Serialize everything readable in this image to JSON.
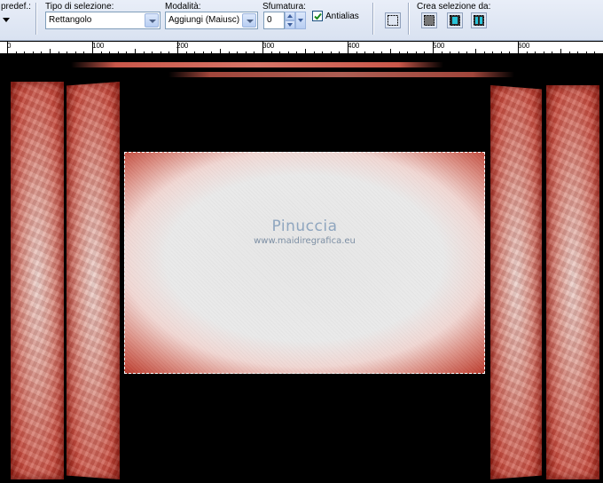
{
  "toolbar": {
    "preset_label": "predef.:",
    "selection_type": {
      "label": "Tipo di selezione:",
      "value": "Rettangolo"
    },
    "mode": {
      "label": "Modalità:",
      "value": "Aggiungi (Maiusc)"
    },
    "feather": {
      "label": "Sfumatura:",
      "value": "0"
    },
    "antialias": {
      "label": "Antialias",
      "checked": true
    },
    "create_selection": {
      "label": "Crea selezione da:"
    }
  },
  "ruler": {
    "labels": [
      "0",
      "100",
      "200",
      "300",
      "400",
      "500",
      "600"
    ]
  },
  "watermark": {
    "title": "Pinuccia",
    "url": "www.maidiregrafica.eu"
  },
  "colors": {
    "toolbar_bg": "#dde5f3",
    "canvas_bg": "#000000",
    "red_frame": "#c24a3c",
    "selection_fill": "#e9e9e9"
  }
}
